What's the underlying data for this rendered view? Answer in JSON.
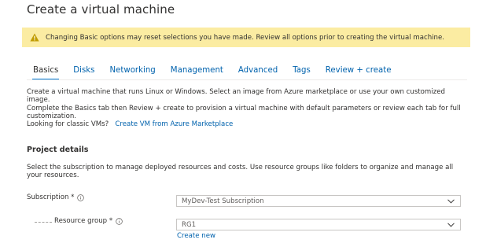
{
  "page": {
    "title": "Create a virtual machine"
  },
  "warning": {
    "icon": "warning-icon",
    "text": "Changing Basic options may reset selections you have made. Review all options prior to creating the virtual machine.",
    "background": "#fbeca2",
    "icon_color": "#c19c00"
  },
  "tabs": [
    {
      "label": "Basics",
      "active": true
    },
    {
      "label": "Disks",
      "active": false
    },
    {
      "label": "Networking",
      "active": false
    },
    {
      "label": "Management",
      "active": false
    },
    {
      "label": "Advanced",
      "active": false
    },
    {
      "label": "Tags",
      "active": false
    },
    {
      "label": "Review + create",
      "active": false
    }
  ],
  "intro": {
    "line1": "Create a virtual machine that runs Linux or Windows. Select an image from Azure marketplace or use your own customized image.",
    "line2": "Complete the Basics tab then Review + create to provision a virtual machine with default parameters or review each tab for full customization.",
    "classic_prefix": "Looking for classic VMs?",
    "classic_link": "Create VM from Azure Marketplace"
  },
  "project_details": {
    "title": "Project details",
    "description": "Select the subscription to manage deployed resources and costs. Use resource groups like folders to organize and manage all your resources."
  },
  "form": {
    "subscription": {
      "label": "Subscription *",
      "value": "MyDev-Test Subscription"
    },
    "resource_group": {
      "label": "Resource group *",
      "value": "RG1",
      "create_new": "Create new"
    }
  },
  "colors": {
    "link": "#0062ad",
    "accent": "#0078d4",
    "text": "#323130"
  }
}
